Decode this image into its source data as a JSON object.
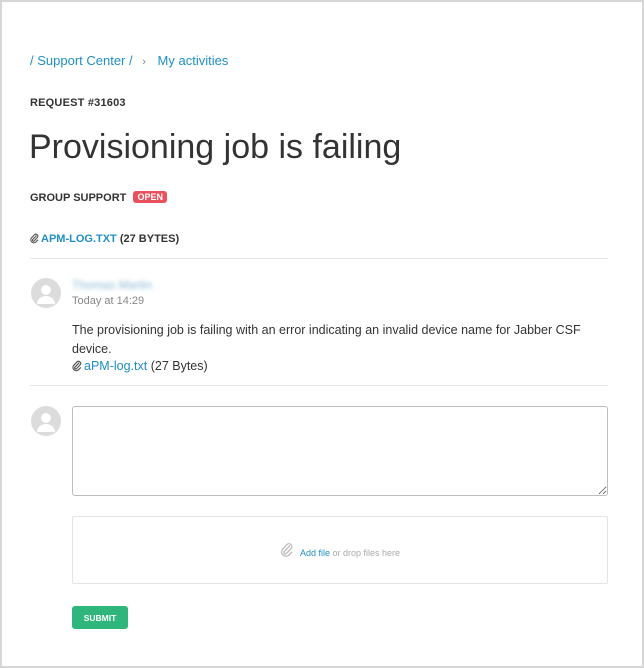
{
  "breadcrumb": {
    "support_center": "/ Support Center /",
    "separator": "›",
    "my_activities": "My activities"
  },
  "request": {
    "id_label": "REQUEST #31603",
    "title": "Provisioning job is failing",
    "group_label": "GROUP SUPPORT",
    "status": "OPEN",
    "attachment_name": "APM-LOG.TXT",
    "attachment_size": "(27 BYTES)"
  },
  "comment": {
    "author": "Thomas Martin",
    "timestamp": "Today at 14:29",
    "body": "The provisioning job is failing with an error indicating an invalid device name for Jabber CSF device.",
    "attachment_name": "aPM-log.txt",
    "attachment_size": "(27 Bytes)"
  },
  "reply": {
    "textarea_value": "",
    "add_file_label": "Add file",
    "drop_hint": "or drop files here",
    "submit_label": "SUBMIT"
  },
  "colors": {
    "link": "#1f8fc4",
    "badge_open": "#e8515d",
    "submit": "#2eb67d"
  },
  "icons": [
    "paperclip-icon",
    "avatar-icon"
  ]
}
